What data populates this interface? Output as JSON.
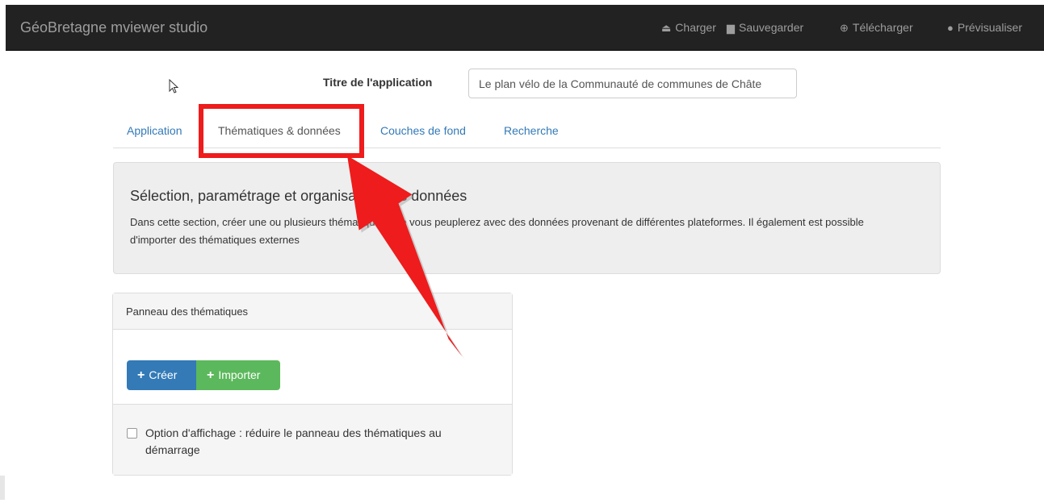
{
  "navbar": {
    "brand": "GéoBretagne mviewer studio",
    "items": [
      {
        "label": "Charger",
        "icon": "upload-icon"
      },
      {
        "label": "Sauvegarder",
        "icon": "floppy-disk-icon"
      },
      {
        "label": "Télécharger",
        "icon": "download-circle-icon"
      },
      {
        "label": "Prévisualiser",
        "icon": "globe-icon"
      }
    ],
    "background": "#222222",
    "text_color": "#9d9d9d"
  },
  "app_title": {
    "label": "Titre de l'application",
    "value": "Le plan vélo de la Communauté de communes de Châte"
  },
  "tabs": [
    {
      "label": "Application",
      "active": false
    },
    {
      "label": "Thématiques & données",
      "active": true
    },
    {
      "label": "Couches de fond",
      "active": false
    },
    {
      "label": "Recherche",
      "active": false
    }
  ],
  "section": {
    "title": "Sélection, paramétrage et organisation des données",
    "description": "Dans cette section, créer une ou plusieurs thématiques que vous peuplerez avec des données provenant de différentes plateformes. Il également est possible d'importer des thématiques externes"
  },
  "panel": {
    "heading": "Panneau des thématiques",
    "create_label": "Créer",
    "import_label": "Importer",
    "option_label": "Option d'affichage : réduire le panneau des thématiques au démarrage",
    "option_checked": false
  },
  "colors": {
    "primary": "#337ab7",
    "success": "#5cb85c",
    "annotation_red": "#ee1c1c"
  }
}
